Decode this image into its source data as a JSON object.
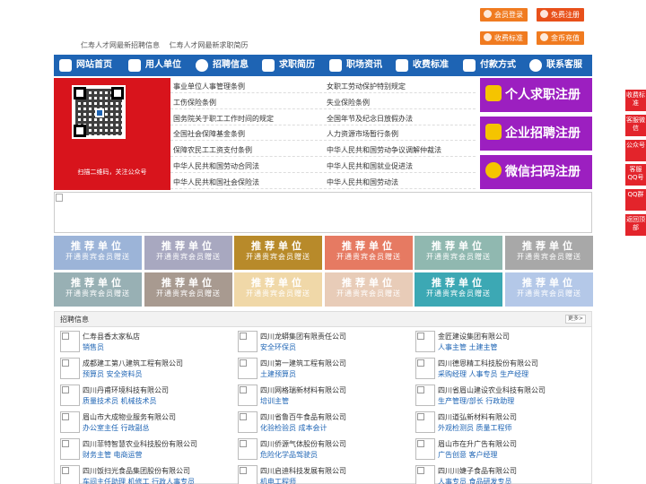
{
  "top_buttons": [
    {
      "label": "会员登录",
      "color": "#f07b20"
    },
    {
      "label": "免费注册",
      "color": "#e8501a"
    },
    {
      "label": "收费标准",
      "color": "#f07b20"
    },
    {
      "label": "金币充值",
      "color": "#f07b20"
    }
  ],
  "head_links": [
    "仁寿人才网最新招聘信息",
    "仁寿人才网最新求职简历"
  ],
  "nav": [
    {
      "label": "网站首页",
      "icon": "home-icon"
    },
    {
      "label": "用人单位",
      "icon": "building-icon"
    },
    {
      "label": "招聘信息",
      "icon": "chat-icon"
    },
    {
      "label": "求职简历",
      "icon": "resume-icon"
    },
    {
      "label": "职场资讯",
      "icon": "news-icon"
    },
    {
      "label": "收费标准",
      "icon": "price-icon"
    },
    {
      "label": "付款方式",
      "icon": "payment-icon"
    },
    {
      "label": "联系客服",
      "icon": "phone-icon"
    }
  ],
  "qr_caption": "扫描二维码，关注公众号",
  "laws": [
    [
      "事业单位人事管理条例",
      "女职工劳动保护特别规定"
    ],
    [
      "工伤保险条例",
      "失业保险条例"
    ],
    [
      "国务院关于职工工作时间的规定",
      "全国年节及纪念日放假办法"
    ],
    [
      "全国社会保障基金条例",
      "人力资源市场暂行条例"
    ],
    [
      "保障农民工工资支付条例",
      "中华人民共和国劳动争议调解仲裁法"
    ],
    [
      "中华人民共和国劳动合同法",
      "中华人民共和国就业促进法"
    ],
    [
      "中华人民共和国社会保险法",
      "中华人民共和国劳动法"
    ]
  ],
  "register_buttons": [
    "个人求职注册",
    "企业招聘注册",
    "微信扫码注册"
  ],
  "recommend_tiles": {
    "title": "推荐单位",
    "subtitle": "开通贵宾会员赠送",
    "colors": [
      "#9cb4d8",
      "#a8a8c0",
      "#b88a2a",
      "#e67a62",
      "#90b8b0",
      "#a8a8a8",
      "#98b0b4",
      "#a89a90",
      "#f0d8a8",
      "#e8ccb8",
      "#3ca8b4",
      "#b4c8e8"
    ]
  },
  "jobs_panel": {
    "title": "招聘信息",
    "more_label": "更多>",
    "items": [
      {
        "company": "仁寿县香太家私店",
        "posts": "销售员"
      },
      {
        "company": "四川龙蟒集团有限责任公司",
        "posts": "安全环保员"
      },
      {
        "company": "金匠建设集团有限公司",
        "posts": "人事主管  土建主管"
      },
      {
        "company": "成都建工第八建筑工程有限公司",
        "posts": "预算员  安全资料员"
      },
      {
        "company": "四川第一建筑工程有限公司",
        "posts": "土建预算员"
      },
      {
        "company": "四川德恩精工科技股份有限公司",
        "posts": "采购经理  人事专员  生产经理"
      },
      {
        "company": "四川丹甫环境科技有限公司",
        "posts": "质量技术员  机械技术员"
      },
      {
        "company": "四川网格瑞新材料有限公司",
        "posts": "培训主管"
      },
      {
        "company": "四川省眉山建设农业科技有限公司",
        "posts": "生产管理/部长  行政助理"
      },
      {
        "company": "眉山市大成物业服务有限公司",
        "posts": "办公室主任  行政副总"
      },
      {
        "company": "四川省鲁百牛食品有限公司",
        "posts": "化验检验员  成本会计"
      },
      {
        "company": "四川道弘新材料有限公司",
        "posts": "外观检测员  质量工程师"
      },
      {
        "company": "四川菲特智慧农业科技股份有限公司",
        "posts": "财务主管  电商运营"
      },
      {
        "company": "四川侨源气体股份有限公司",
        "posts": "危险化学品驾驶员"
      },
      {
        "company": "眉山市在升广告有限公司",
        "posts": "广告创意  客户经理"
      },
      {
        "company": "四川饭扫光食品集团股份有限公司",
        "posts": "车间主任助理  机修工  行政人事专员"
      },
      {
        "company": "四川启迪科技发展有限公司",
        "posts": "机电工程师"
      },
      {
        "company": "四川川婕子食品有限公司",
        "posts": "人事专员  食品研发专员"
      }
    ]
  },
  "side_tabs": [
    "收费标准",
    "客服微信",
    "公众号",
    "客服QQ号",
    "QQ群",
    "返回顶部"
  ],
  "colors": {
    "nav_bg": "#1e64b4",
    "side_bg": "#e3242b",
    "register_bg": "#9c1fc0",
    "qr_bg": "#d8141c"
  }
}
